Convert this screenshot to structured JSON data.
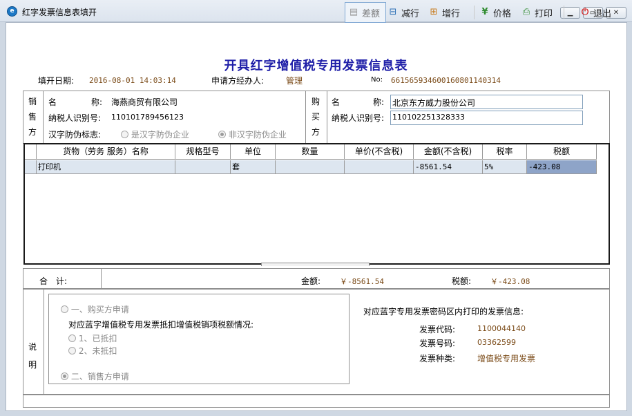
{
  "window": {
    "title": "红字发票信息表填开",
    "app_icon": "app-logo-icon"
  },
  "toolbar": {
    "diff": "差额",
    "decrease": "减行",
    "increase": "增行",
    "price": "价格",
    "print": "打印",
    "exit": "退出"
  },
  "form": {
    "title": "开具红字增值税专用发票信息表",
    "date_label": "填开日期:",
    "date_value": "2016-08-01 14:03:14",
    "operator_label": "申请方经办人:",
    "operator_value": "管理",
    "no_label": "No:",
    "no_value": "661565934600160801140314"
  },
  "seller": {
    "side_label": [
      "销",
      "售",
      "方"
    ],
    "name_label": "名 称:",
    "name_value": "海燕商贸有限公司",
    "tax_id_label": "纳税人识别号:",
    "tax_id_value": "110101789456123",
    "anti_fake_label": "汉字防伪标志:",
    "option_yes": "是汉字防伪企业",
    "option_no": "非汉字防伪企业",
    "selected": "option_no"
  },
  "buyer": {
    "side_label": [
      "购",
      "买",
      "方"
    ],
    "name_label": "名 称:",
    "name_value": "北京东方威力股份公司",
    "tax_id_label": "纳税人识别号:",
    "tax_id_value": "110102251328333"
  },
  "grid": {
    "columns": [
      "货物（劳务 服务）名称",
      "规格型号",
      "单位",
      "数量",
      "单价(不含税)",
      "金额(不含税)",
      "税率",
      "税额"
    ],
    "rows": [
      [
        "打印机",
        "",
        "套",
        "",
        "",
        "-8561.54",
        "5%",
        "-423.08"
      ]
    ]
  },
  "totals": {
    "label": "合 计:",
    "amount_label": "金额:",
    "amount_value": "￥-8561.54",
    "tax_label": "税额:",
    "tax_value": "￥-423.08"
  },
  "remarks": {
    "side_label": [
      "说",
      "明"
    ],
    "option_buyer": "一、购买方申请",
    "deduct_question": "对应蓝字增值税专用发票抵扣增值税销项税额情况:",
    "deducted": "1、已抵扣",
    "not_deducted": "2、未抵扣",
    "option_seller": "二、销售方申请",
    "selected": "option_seller",
    "info_title": "对应蓝字专用发票密码区内打印的发票信息:",
    "code_label": "发票代码:",
    "code_value": "1100044140",
    "number_label": "发票号码:",
    "number_value": "03362599",
    "type_label": "发票种类:",
    "type_value": "增值税专用发票"
  },
  "colors": {
    "title_blue": "#1f1fa8",
    "value_brown": "#7a4a17",
    "selection": "#8ea4c8",
    "row_bg": "#dde6f0"
  }
}
